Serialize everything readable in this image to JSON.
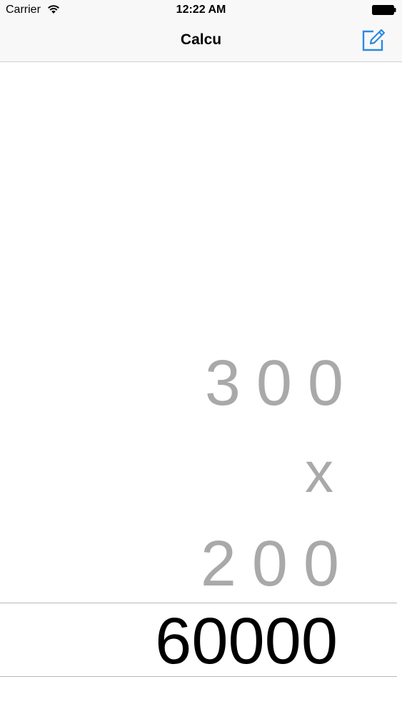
{
  "status_bar": {
    "carrier": "Carrier",
    "time": "12:22 AM"
  },
  "nav": {
    "title": "Calcu",
    "compose_icon": "compose-icon"
  },
  "display": {
    "operand_1": "300",
    "operator": "x",
    "operand_2": "200",
    "result": "60000"
  },
  "colors": {
    "accent": "#2a8be0",
    "operand_gray": "#a9a9a9",
    "bar_background": "#f8f8f8"
  }
}
